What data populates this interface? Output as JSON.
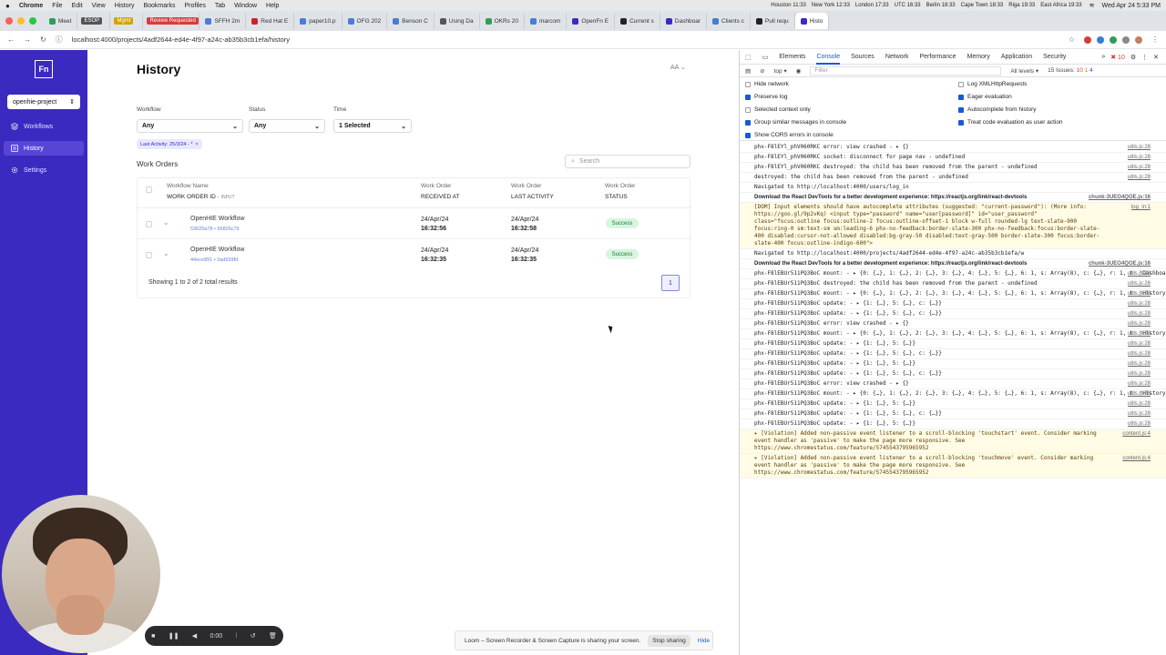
{
  "menubar": {
    "app": "Chrome",
    "items": [
      "File",
      "Edit",
      "View",
      "History",
      "Bookmarks",
      "Profiles",
      "Tab",
      "Window",
      "Help"
    ],
    "clocks": [
      "Houston 11:33",
      "New York 12:33",
      "London 17:33",
      "UTC 16:33",
      "Berlin 18:33",
      "Cape Town 18:33",
      "Riga 19:33",
      "East Africa 19:33"
    ],
    "datetime": "Wed Apr 24  5:33 PM"
  },
  "tabs": [
    {
      "label": "Meet",
      "color": "#2f9e55"
    },
    {
      "label": "ESOP",
      "badge": true,
      "color": "#555"
    },
    {
      "label": "Mgmt",
      "badge": true,
      "color": "#d4a300"
    },
    {
      "label": "Review Requested",
      "badge": true,
      "color": "#d83b3b"
    },
    {
      "label": "SFFH 2m",
      "color": "#4a7bd8"
    },
    {
      "label": "Red Hat E",
      "color": "#c22"
    },
    {
      "label": "paper10.p",
      "color": "#4a7bd8"
    },
    {
      "label": "OFG 202",
      "color": "#4a7bd8"
    },
    {
      "label": "Benson C",
      "color": "#4a7bd8"
    },
    {
      "label": "Using Da",
      "color": "#555"
    },
    {
      "label": "OKRs 20",
      "color": "#2f9e55"
    },
    {
      "label": "marcom",
      "color": "#4a7bd8"
    },
    {
      "label": "OpenFn E",
      "color": "#3b2ac0"
    },
    {
      "label": "Current s",
      "color": "#222"
    },
    {
      "label": "Dashboar",
      "color": "#3b2ac0"
    },
    {
      "label": "Clients c",
      "color": "#4a7bd8"
    },
    {
      "label": "Pull requ",
      "color": "#222"
    },
    {
      "label": "Histo",
      "color": "#3b2ac0",
      "active": true
    }
  ],
  "address": {
    "url": "localhost:4000/projects/4adf2644-ed4e-4f97-a24c-ab35b3cb1efa/history"
  },
  "sidebar": {
    "logo": "Fn",
    "project": "openhie-project",
    "items": [
      {
        "label": "Workflows"
      },
      {
        "label": "History",
        "active": true
      },
      {
        "label": "Settings"
      }
    ]
  },
  "main": {
    "title": "History",
    "avatar": "AA",
    "filters": {
      "workflow_label": "Workflow",
      "workflow_value": "Any",
      "status_label": "Status",
      "status_value": "Any",
      "time_label": "Time",
      "time_value": "1 Selected"
    },
    "chip": "Last Activity: 25/3/24 - *",
    "section_title": "Work Orders",
    "search_placeholder": "Search",
    "columns": {
      "c1a": "Workflow Name",
      "c1b": "WORK ORDER ID",
      "c1c": "INPUT",
      "c2a": "Work Order",
      "c2b": "RECEIVED AT",
      "c3a": "Work Order",
      "c3b": "LAST ACTIVITY",
      "c4a": "Work Order",
      "c4b": "STATUS"
    },
    "rows": [
      {
        "name": "OpenHIE Workflow",
        "ids": "53620a78 • 65826c79",
        "received_date": "24/Apr/24",
        "received_time": "16:32:56",
        "activity_date": "24/Apr/24",
        "activity_time": "16:32:58",
        "status": "Success"
      },
      {
        "name": "OpenHIE Workflow",
        "ids": "44ece891 • 3ad939fd",
        "received_date": "24/Apr/24",
        "received_time": "16:32:35",
        "activity_date": "24/Apr/24",
        "activity_time": "16:32:35",
        "status": "Success"
      }
    ],
    "pager_text": "Showing 1 to 2 of 2 total results",
    "pager_page": "1"
  },
  "devtools": {
    "tabs": [
      "Elements",
      "Console",
      "Sources",
      "Network",
      "Performance",
      "Memory",
      "Application",
      "Security"
    ],
    "issues_errors": "10",
    "issues_total": "15 Issues:",
    "issues_e": "10",
    "issues_w": "1",
    "issues_i": "4",
    "context": "top",
    "filter_placeholder": "Filter",
    "levels": "All levels",
    "settings_left": [
      "Hide network",
      "Preserve log",
      "Selected context only",
      "Group similar messages in console",
      "Show CORS errors in console"
    ],
    "settings_right": [
      "Log XMLHttpRequests",
      "Eager evaluation",
      "Autocomplete from history",
      "Treat code evaluation as user action"
    ],
    "logs": [
      {
        "text": "phx-F8lEYl_phV060RKC error: view crashed -  ▸ {}",
        "src": "utils.js:28"
      },
      {
        "text": "phx-F8lEYl_phV060RKC socket: disconnect for page nav -  undefined",
        "src": "utils.js:28"
      },
      {
        "text": "phx-F8lEYl_phV060RKC destroyed: the child has been removed from the parent -  undefined",
        "src": "utils.js:28"
      },
      {
        "text": "  destroyed: the child has been removed from the parent -  undefined",
        "src": "utils.js:28"
      },
      {
        "text": "Navigated to http://localhost:4000/users/log_in",
        "src": ""
      },
      {
        "text": "Download the React DevTools for a better development experience: https://reactjs.org/link/react-devtools",
        "src": "chunk-3UEO4QOE.js:16",
        "bold": true
      },
      {
        "text": "[DOM] Input elements should have autocomplete attributes (suggested: \"current-password\"): (More info: https://goo.gl/9p2vKq) <input type=\"password\" name=\"user[password]\" id=\"user_password\" class=\"focus:outline focus:outline-2 focus:outline-offset-1 block w-full rounded-lg text-slate-900 focus:ring-0 sm:text-sm sm:leading-6 phx-no-feedback:border-slate-300 phx-no-feedback:focus:border-slate-400 disabled:cursor-not-allowed disabled:bg-gray-50 disabled:text-gray-500 border-slate-300 focus:border-slate-400 focus:outline-indigo-600\">",
        "src": "log_in:1",
        "warn": true
      },
      {
        "text": "Navigated to http://localhost:4000/projects/4adf2644-ed4e-4f97-a24c-ab35b3cb1efa/w",
        "src": ""
      },
      {
        "text": "Download the React DevTools for a better development experience: https://reactjs.org/link/react-devtools",
        "src": "chunk-3UEO4QOE.js:16",
        "bold": true
      },
      {
        "text": "phx-F8lEBUr511PQ3BoC mount:  -  ▸ {0: {…}, 1: {…}, 2: {…}, 3: {…}, 4: {…}, 5: {…}, 6: 1, s: Array(8), c: {…}, r: 1, t: 'Dashboard'}",
        "src": "utils.js:28"
      },
      {
        "text": "phx-F8lEBUr511PQ3BoC destroyed: the child has been removed from the parent -  undefined",
        "src": "utils.js:28"
      },
      {
        "text": "phx-F8lEBUr511PQ3BoC mount:  -  ▸ {0: {…}, 1: {…}, 2: {…}, 3: {…}, 4: {…}, 5: {…}, 6: 1, s: Array(8), c: {…}, r: 1, t: 'History'}",
        "src": "utils.js:28"
      },
      {
        "text": "phx-F8lEBUr511PQ3BoC update:  -  ▸ {1: {…}, 5: {…}, c: {…}}",
        "src": "utils.js:28"
      },
      {
        "text": "phx-F8lEBUr511PQ3BoC update:  -  ▸ {1: {…}, 5: {…}, c: {…}}",
        "src": "utils.js:28"
      },
      {
        "text": "phx-F8lEBUr511PQ3BoC error: view crashed -  ▸ {}",
        "src": "utils.js:28"
      },
      {
        "text": "phx-F8lEBUr511PQ3BoC mount:  -  ▸ {0: {…}, 1: {…}, 2: {…}, 3: {…}, 4: {…}, 5: {…}, 6: 1, s: Array(8), c: {…}, r: 1, t: 'History'}",
        "src": "utils.js:28"
      },
      {
        "text": "phx-F8lEBUr511PQ3BoC update:  -  ▸ {1: {…}, 5: {…}}",
        "src": "utils.js:28"
      },
      {
        "text": "phx-F8lEBUr511PQ3BoC update:  -  ▸ {1: {…}, 5: {…}, c: {…}}",
        "src": "utils.js:28"
      },
      {
        "text": "phx-F8lEBUr511PQ3BoC update:  -  ▸ {1: {…}, 5: {…}}",
        "src": "utils.js:28"
      },
      {
        "text": "phx-F8lEBUr511PQ3BoC update:  -  ▸ {1: {…}, 5: {…}, c: {…}}",
        "src": "utils.js:28"
      },
      {
        "text": "phx-F8lEBUr511PQ3BoC error: view crashed -  ▸ {}",
        "src": "utils.js:28"
      },
      {
        "text": "phx-F8lEBUr511PQ3BoC mount:  -  ▸ {0: {…}, 1: {…}, 2: {…}, 3: {…}, 4: {…}, 5: {…}, 6: 1, s: Array(8), c: {…}, r: 1, t: 'History'}",
        "src": "utils.js:28"
      },
      {
        "text": "phx-F8lEBUr511PQ3BoC update:  -  ▸ {1: {…}, 5: {…}}",
        "src": "utils.js:28"
      },
      {
        "text": "phx-F8lEBUr511PQ3BoC update:  -  ▸ {1: {…}, 5: {…}, c: {…}}",
        "src": "utils.js:28"
      },
      {
        "text": "phx-F8lEBUr511PQ3BoC update:  -  ▸ {1: {…}, 5: {…}}",
        "src": "utils.js:28"
      },
      {
        "text": "▸ [Violation] Added non-passive event listener to a scroll-blocking 'touchstart' event. Consider marking event handler as 'passive' to make the page more responsive. See https://www.chromestatus.com/feature/5745543795965952",
        "src": "content.js:4",
        "warn": true
      },
      {
        "text": "▸ [Violation] Added non-passive event listener to a scroll-blocking 'touchmove' event. Consider marking event handler as 'passive' to make the page more responsive. See https://www.chromestatus.com/feature/5745543795965952",
        "src": "content.js:4",
        "warn": true
      }
    ]
  },
  "recorder": {
    "time": "0:00"
  },
  "share_banner": {
    "text": "Loom – Screen Recorder & Screen Capture is sharing your screen.",
    "stop": "Stop sharing",
    "hide": "Hide"
  }
}
